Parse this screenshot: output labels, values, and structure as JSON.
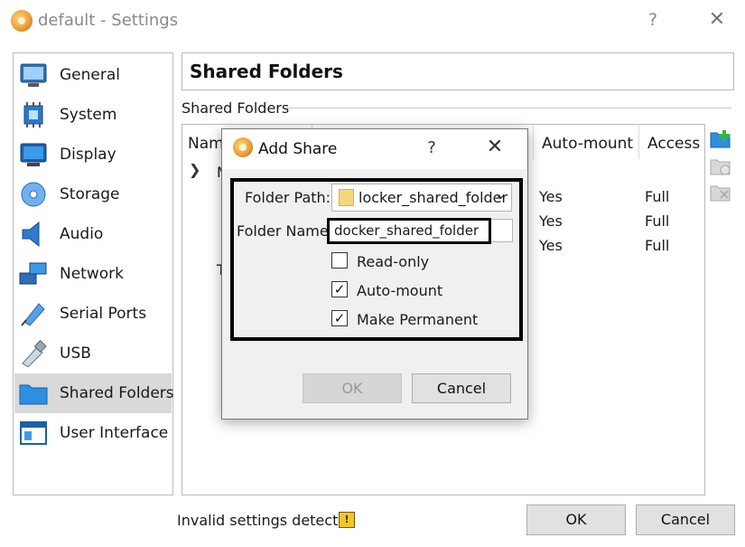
{
  "window": {
    "title": "default - Settings",
    "help_glyph": "?",
    "close_glyph": "✕"
  },
  "sidebar": {
    "items": [
      {
        "label": "General",
        "icon": "general-icon"
      },
      {
        "label": "System",
        "icon": "system-chip-icon"
      },
      {
        "label": "Display",
        "icon": "display-monitor-icon"
      },
      {
        "label": "Storage",
        "icon": "storage-disk-icon"
      },
      {
        "label": "Audio",
        "icon": "audio-speaker-icon"
      },
      {
        "label": "Network",
        "icon": "network-icon"
      },
      {
        "label": "Serial Ports",
        "icon": "serial-port-icon"
      },
      {
        "label": "USB",
        "icon": "usb-icon"
      },
      {
        "label": "Shared Folders",
        "icon": "shared-folder-icon",
        "selected": true
      },
      {
        "label": "User Interface",
        "icon": "user-interface-icon"
      }
    ]
  },
  "main": {
    "page_title": "Shared Folders",
    "section_label": "Shared Folders",
    "table": {
      "col_name_fragment": "Nam",
      "col_automount": "Auto-mount",
      "col_access": "Access",
      "group_fragment": "M",
      "group2_fragment": "T",
      "rows": [
        {
          "automount": "Yes",
          "access": "Full"
        },
        {
          "automount": "Yes",
          "access": "Full"
        },
        {
          "automount": "Yes",
          "access": "Full"
        }
      ]
    }
  },
  "footer": {
    "status_text": "Invalid settings detected",
    "ok_label": "OK",
    "cancel_label": "Cancel"
  },
  "dialog": {
    "title": "Add Share",
    "help_glyph": "?",
    "close_glyph": "✕",
    "folder_path_label": "Folder Path:",
    "folder_path_value": "locker_shared_folder",
    "folder_name_label": "Folder Name:",
    "folder_name_value": "docker_shared_folder",
    "readonly_label": "Read-only",
    "readonly_checked": false,
    "automount_label": "Auto-mount",
    "automount_checked": true,
    "permanent_label": "Make Permanent",
    "permanent_checked": true,
    "ok_label": "OK",
    "cancel_label": "Cancel"
  },
  "colors": {
    "selection": "#d9d9d9",
    "highlight_border": "#000000",
    "dialog_bg": "#f0f0f0"
  }
}
